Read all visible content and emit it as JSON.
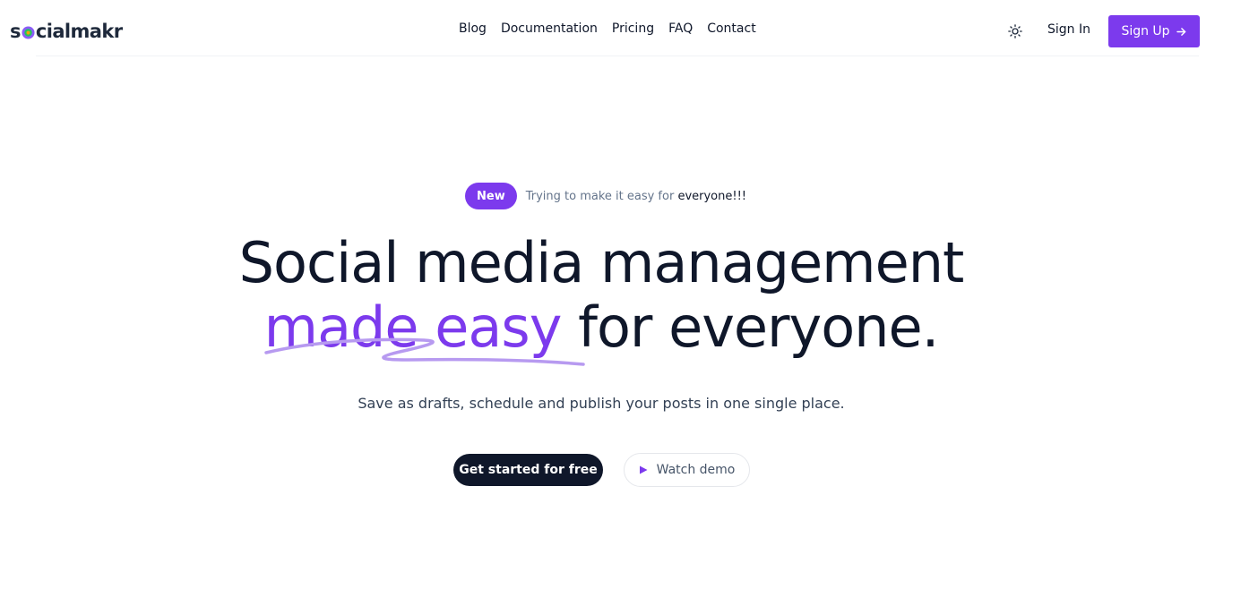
{
  "brand": {
    "name_before": "s",
    "name_after": "cialmakr",
    "accent": "#7c3aed",
    "dark": "#0f172a"
  },
  "nav": {
    "items": [
      "Blog",
      "Documentation",
      "Pricing",
      "FAQ",
      "Contact"
    ]
  },
  "header": {
    "theme_icon": "sun-icon",
    "sign_in": "Sign In",
    "sign_up": "Sign Up",
    "sign_up_icon": "arrow-right-icon"
  },
  "hero": {
    "badge": "New",
    "announcement_start": "Trying to make it easy for ",
    "announcement_end": "everyone!!!",
    "headline_line1": "Social media management",
    "headline_highlight": "made easy",
    "headline_rest": " for everyone.",
    "subtitle": "Save as drafts, schedule and publish your posts in one single place.",
    "cta_primary": "Get started for free",
    "cta_secondary": "Watch demo",
    "cta_secondary_icon": "play-icon"
  }
}
